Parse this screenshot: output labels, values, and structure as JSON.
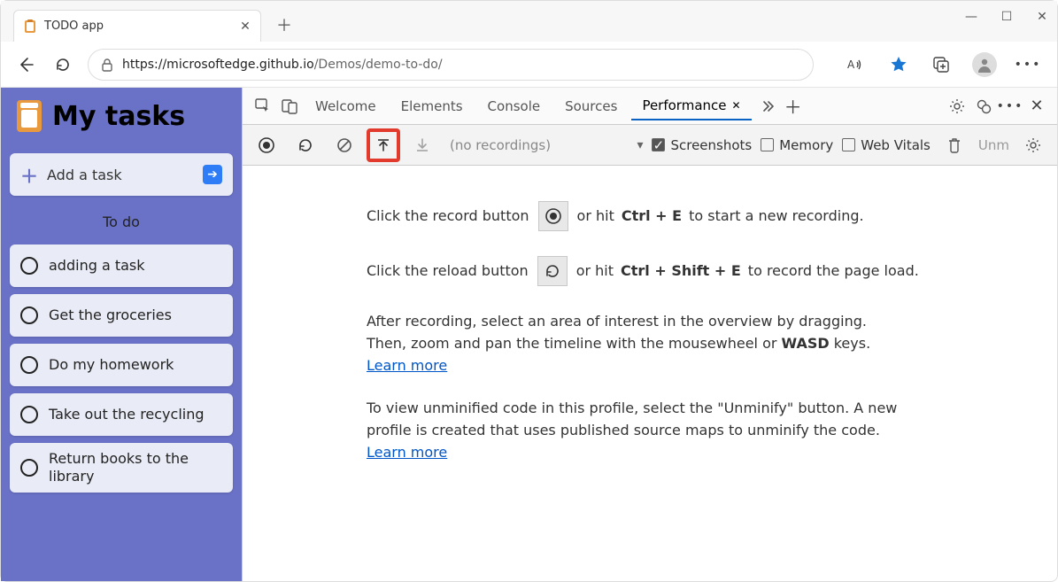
{
  "browser": {
    "tab_title": "TODO app",
    "url_host": "https://microsoftedge.github.io",
    "url_path": "/Demos/demo-to-do/"
  },
  "app": {
    "title": "My tasks",
    "add_task_label": "Add a task",
    "section_title": "To do",
    "tasks": [
      "adding a task",
      "Get the groceries",
      "Do my homework",
      "Take out the recycling",
      "Return books to the library"
    ]
  },
  "devtools": {
    "tabs": {
      "welcome": "Welcome",
      "elements": "Elements",
      "console": "Console",
      "sources": "Sources",
      "performance": "Performance"
    },
    "perf": {
      "placeholder": "(no recordings)",
      "screenshots_label": "Screenshots",
      "memory_label": "Memory",
      "web_vitals_label": "Web Vitals",
      "unminify_label": "Unm"
    },
    "body": {
      "record_pre": "Click the record button",
      "record_post_1": "or hit",
      "record_hotkey": "Ctrl + E",
      "record_post_2": "to start a new recording.",
      "reload_pre": "Click the reload button",
      "reload_post_1": "or hit",
      "reload_hotkey": "Ctrl + Shift + E",
      "reload_post_2": "to record the page load.",
      "para1_a": "After recording, select an area of interest in the overview by dragging. Then, zoom and pan the timeline with the mousewheel or ",
      "wasd": "WASD",
      "para1_b": " keys. ",
      "learn_more": "Learn more",
      "para2_a": "To view unminified code in this profile, select the \"Unminify\" button. A new profile is created that uses published source maps to unminify the code. "
    }
  }
}
